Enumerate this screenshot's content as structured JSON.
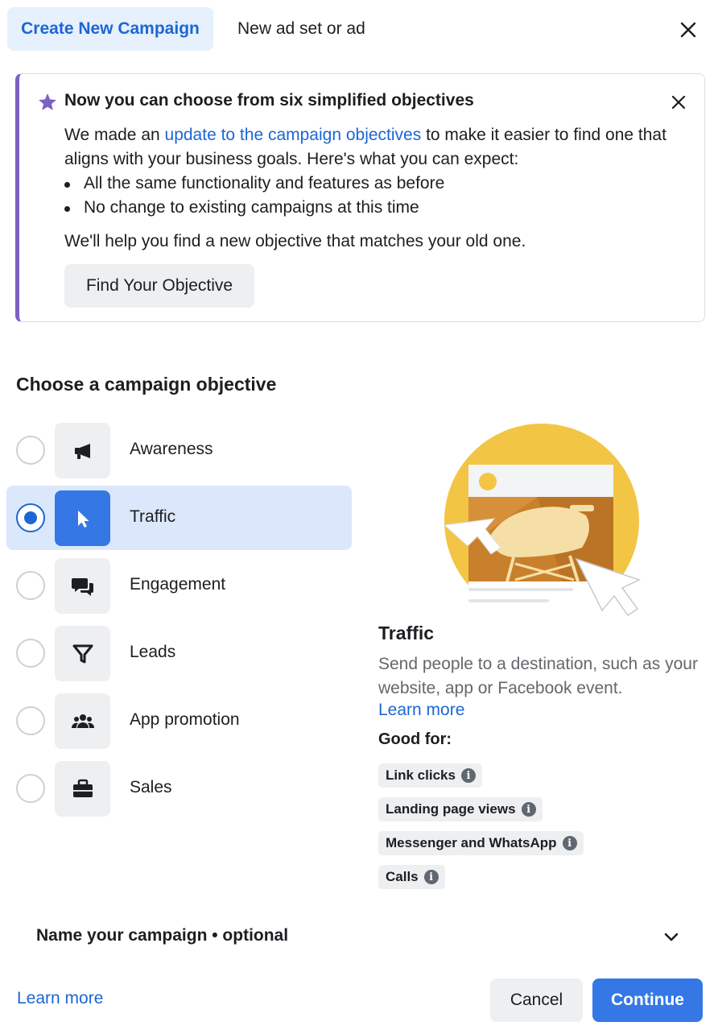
{
  "header": {
    "tab_active": "Create New Campaign",
    "tab_inactive": "New ad set or ad"
  },
  "notice": {
    "title": "Now you can choose from six simplified objectives",
    "intro_before_link": "We made an ",
    "link_text": "update to the campaign objectives",
    "intro_after_link": " to make it easier to find one that aligns with your business goals. Here's what you can expect:",
    "bullets": [
      "All the same functionality and features as before",
      "No change to existing campaigns at this time"
    ],
    "footer": "We'll help you find a new objective that matches your old one.",
    "button": "Find Your Objective"
  },
  "objectives": {
    "title": "Choose a campaign objective",
    "items": [
      {
        "label": "Awareness",
        "icon": "megaphone-icon",
        "selected": false
      },
      {
        "label": "Traffic",
        "icon": "cursor-icon",
        "selected": true
      },
      {
        "label": "Engagement",
        "icon": "chat-bubbles-icon",
        "selected": false
      },
      {
        "label": "Leads",
        "icon": "funnel-icon",
        "selected": false
      },
      {
        "label": "App promotion",
        "icon": "people-icon",
        "selected": false
      },
      {
        "label": "Sales",
        "icon": "briefcase-icon",
        "selected": false
      }
    ]
  },
  "detail": {
    "title": "Traffic",
    "description": "Send people to a destination, such as your website, app or Facebook event.",
    "learn_more": "Learn more",
    "good_for_label": "Good for:",
    "chips": [
      "Link clicks",
      "Landing page views",
      "Messenger and WhatsApp",
      "Calls"
    ]
  },
  "name_section": {
    "label": "Name your campaign • optional"
  },
  "footer": {
    "learn_more": "Learn more",
    "cancel": "Cancel",
    "continue": "Continue"
  },
  "colors": {
    "accent": "#1b67d4",
    "primary_button": "#3578e5",
    "selected_row": "#dbe7fb",
    "notice_border": "#7b61c4"
  }
}
